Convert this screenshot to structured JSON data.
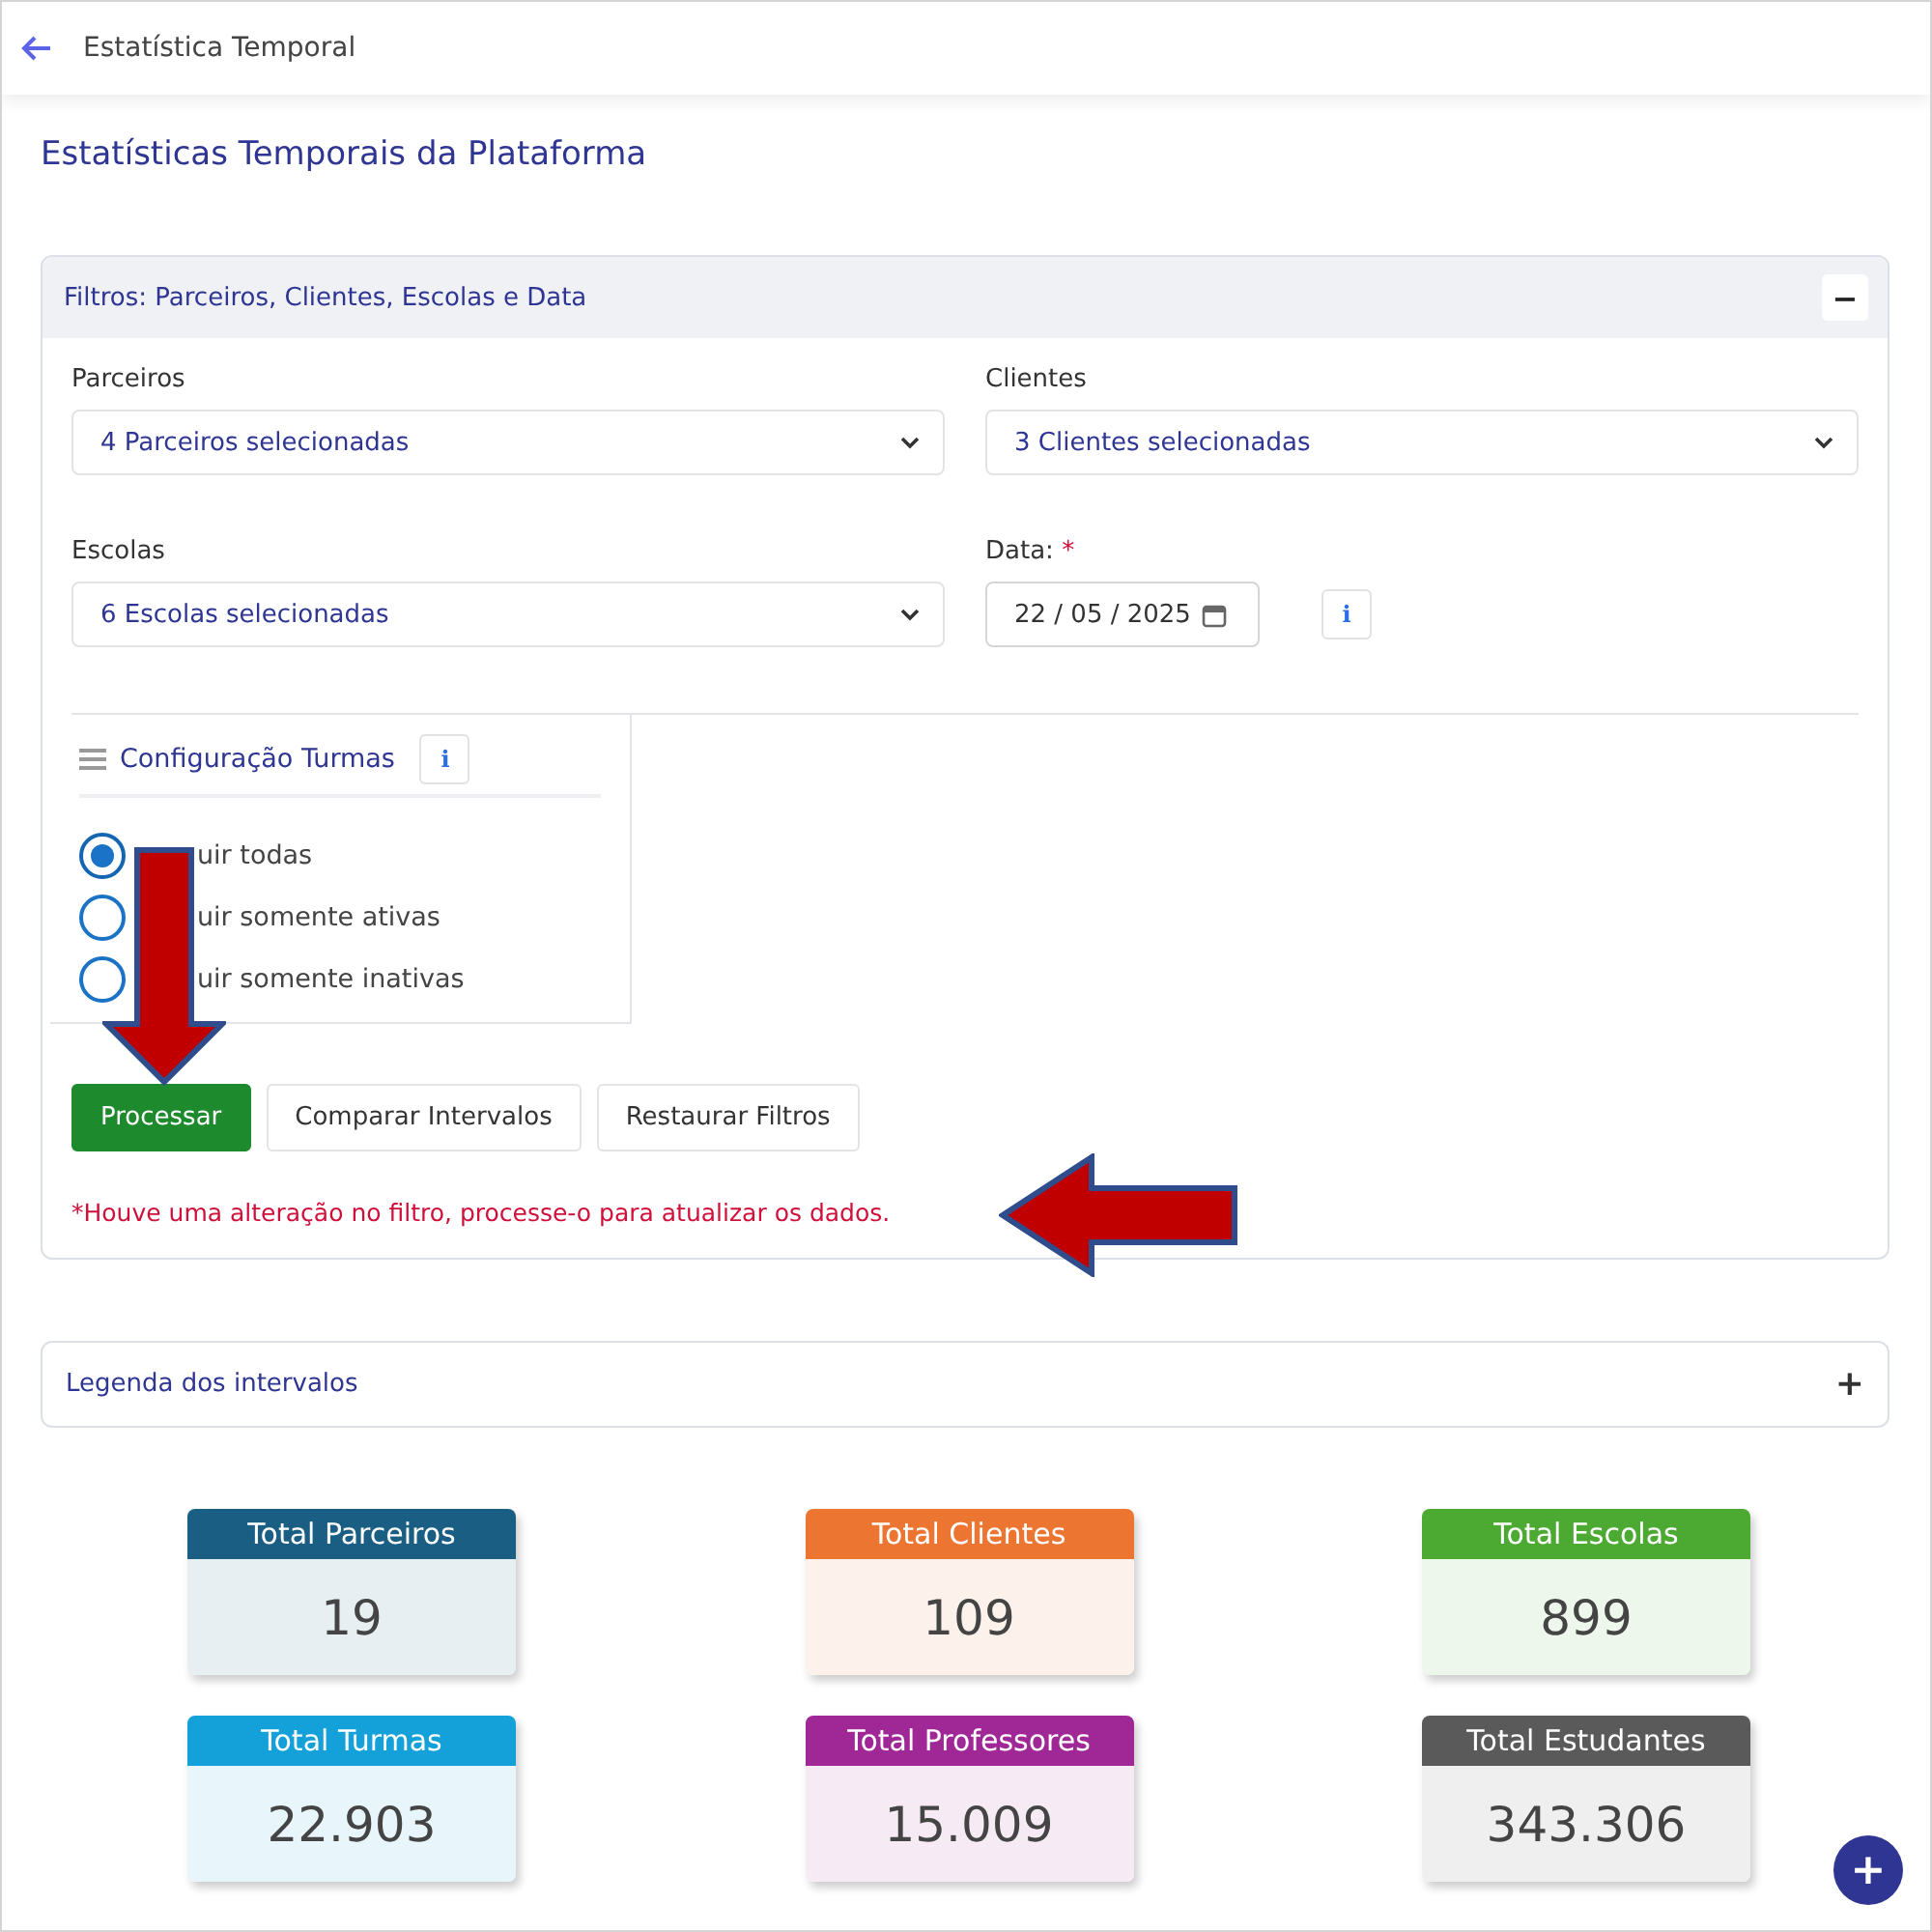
{
  "header": {
    "title": "Estatística Temporal"
  },
  "page_title": "Estatísticas Temporais da Plataforma",
  "filters": {
    "title": "Filtros: Parceiros, Clientes, Escolas e Data",
    "collapse_label": "−",
    "fields": [
      {
        "label": "Parceiros",
        "value": "4 Parceiros selecionadas",
        "kind": "select"
      },
      {
        "label": "Clientes",
        "value": "3 Clientes selecionadas",
        "kind": "select"
      },
      {
        "label": "Escolas",
        "value": "6 Escolas selecionadas",
        "kind": "select"
      },
      {
        "label": "Data:",
        "required": "*",
        "value": "22 / 05 / 2025",
        "kind": "date",
        "info": "i"
      }
    ],
    "config": {
      "title": "Configuração Turmas",
      "info": "i",
      "options": [
        {
          "label": "uir todas",
          "selected": true
        },
        {
          "label": "uir somente ativas",
          "selected": false
        },
        {
          "label": "uir somente inativas",
          "selected": false
        }
      ]
    },
    "buttons": [
      {
        "label": "Processar",
        "kind": "primary"
      },
      {
        "label": "Comparar Intervalos",
        "kind": "default"
      },
      {
        "label": "Restaurar Filtros",
        "kind": "default"
      }
    ],
    "warning": "*Houve uma alteração no filtro, processe-o para atualizar os dados."
  },
  "legend": {
    "title": "Legenda dos intervalos",
    "expand_label": "+"
  },
  "stats": [
    {
      "label": "Total Parceiros",
      "value": "19",
      "color": "#1a5e83"
    },
    {
      "label": "Total Clientes",
      "value": "109",
      "color": "#ec7532"
    },
    {
      "label": "Total Escolas",
      "value": "899",
      "color": "#4caa32"
    },
    {
      "label": "Total Turmas",
      "value": "22.903",
      "color": "#14a0d8"
    },
    {
      "label": "Total Professores",
      "value": "15.009",
      "color": "#a02896"
    },
    {
      "label": "Total Estudantes",
      "value": "343.306",
      "color": "#5a5a5a"
    }
  ],
  "fab": "+"
}
